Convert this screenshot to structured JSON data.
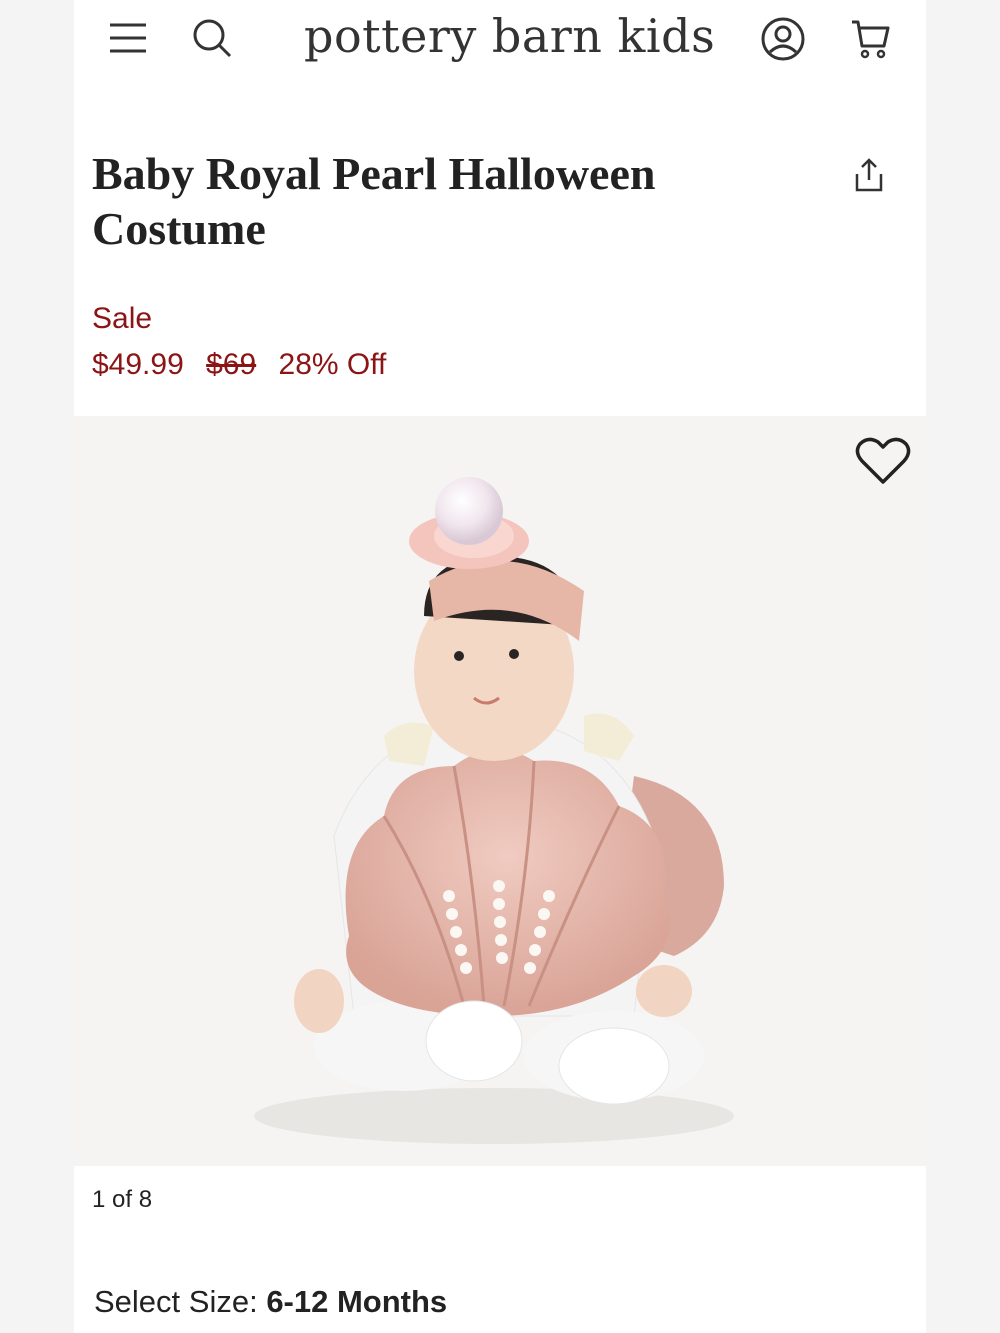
{
  "header": {
    "logo": "pottery barn kids",
    "icons": [
      "menu-icon",
      "search-icon",
      "account-icon",
      "cart-icon"
    ]
  },
  "product": {
    "title_line1": "Baby Royal Pearl Halloween",
    "title_line2": "Costume",
    "sale_label": "Sale",
    "sale_price": "$49.99",
    "original_price": "$69",
    "discount": "28% Off"
  },
  "gallery": {
    "counter": "1 of 8"
  },
  "size": {
    "label": "Select Size: ",
    "value": "6-12 Months"
  },
  "colors": {
    "sale_red": "#8b1414",
    "costume_pink": "#e3b3a8"
  }
}
